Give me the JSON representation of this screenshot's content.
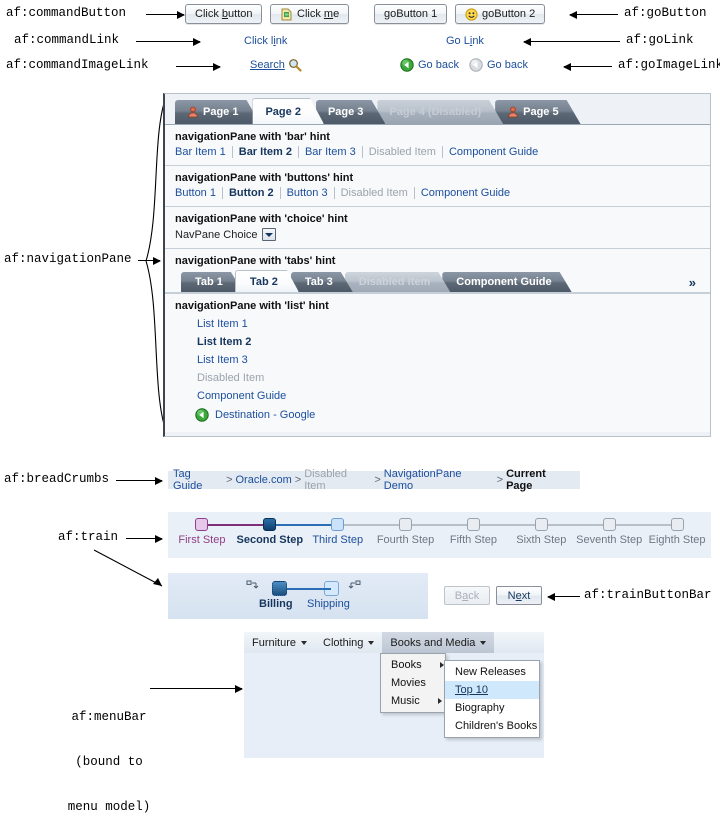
{
  "annotations": {
    "command_button": "af:commandButton",
    "command_link": "af:commandLink",
    "command_image_link": "af:commandImageLink",
    "go_button": "af:goButton",
    "go_link": "af:goLink",
    "go_image_link": "af:goImageLink",
    "navigation_pane": "af:navigationPane",
    "bread_crumbs": "af:breadCrumbs",
    "train": "af:train",
    "train_button_bar": "af:trainButtonBar",
    "menu_bar_line1": "af:menuBar",
    "menu_bar_line2": "(bound to",
    "menu_bar_line3": "menu model)"
  },
  "top_controls": {
    "command_button_1": {
      "pre": "Click ",
      "key": "b",
      "post": "utton"
    },
    "command_button_2": {
      "pre": "Click ",
      "key": "m",
      "post": "e",
      "icon": "page-arrow-icon"
    },
    "go_button_1": {
      "label": "goButton 1"
    },
    "go_button_2": {
      "pre": "goButton 2",
      "icon": "smiley-icon"
    },
    "command_link": {
      "pre": "Click l",
      "key": "i",
      "post": "nk"
    },
    "go_link": {
      "pre": "Go L",
      "key": "i",
      "post": "nk"
    },
    "command_image_link": {
      "label": "Search",
      "icon": "magnifier-icon"
    },
    "go_image_link_1": {
      "label": "Go back",
      "icon": "back-arrow-green-icon"
    },
    "go_image_link_2": {
      "label": "Go back",
      "icon": "back-arrow-gray-icon"
    }
  },
  "nav_panel": {
    "page_tabs": [
      {
        "label": "Page 1",
        "state": "normal",
        "icon": "user-icon"
      },
      {
        "label": "Page 2",
        "state": "selected",
        "icon": ""
      },
      {
        "label": "Page 3",
        "state": "normal",
        "icon": ""
      },
      {
        "label": "Page 4 (Disabled)",
        "state": "disabled",
        "icon": ""
      },
      {
        "label": "Page 5",
        "state": "normal",
        "icon": "user-icon"
      }
    ],
    "sections": [
      {
        "title": "navigationPane with 'bar' hint",
        "items": [
          {
            "label": "Bar Item 1",
            "state": "normal"
          },
          {
            "label": "Bar Item 2",
            "state": "current"
          },
          {
            "label": "Bar Item 3",
            "state": "normal"
          },
          {
            "label": "Disabled Item",
            "state": "disabled"
          },
          {
            "label": "Component Guide",
            "state": "normal"
          }
        ]
      },
      {
        "title": "navigationPane with 'buttons' hint",
        "items": [
          {
            "label": "Button 1",
            "state": "normal"
          },
          {
            "label": "Button 2",
            "state": "current"
          },
          {
            "label": "Button 3",
            "state": "normal"
          },
          {
            "label": "Disabled Item",
            "state": "disabled"
          },
          {
            "label": "Component Guide",
            "state": "normal"
          }
        ]
      }
    ],
    "choice_section": {
      "title": "navigationPane with 'choice' hint",
      "selected": "NavPane Choice"
    },
    "tabs_section": {
      "title": "navigationPane with 'tabs' hint",
      "tabs": [
        {
          "label": "Tab 1",
          "state": "normal"
        },
        {
          "label": "Tab 2",
          "state": "selected"
        },
        {
          "label": "Tab 3",
          "state": "normal"
        },
        {
          "label": "Disabled Item",
          "state": "disabled"
        },
        {
          "label": "Component Guide",
          "state": "normal"
        }
      ],
      "overflow": "»"
    },
    "list_section": {
      "title": "navigationPane with 'list' hint",
      "items": [
        {
          "label": "List Item 1",
          "state": "normal"
        },
        {
          "label": "List Item 2",
          "state": "current"
        },
        {
          "label": "List Item 3",
          "state": "normal"
        },
        {
          "label": "Disabled Item",
          "state": "disabled"
        },
        {
          "label": "Component Guide",
          "state": "normal"
        },
        {
          "label": "Destination - Google",
          "state": "normal",
          "icon": "back-arrow-green-icon"
        }
      ]
    }
  },
  "breadcrumbs": {
    "separator": ">",
    "items": [
      {
        "label": "Tag Guide",
        "state": "normal"
      },
      {
        "label": "Oracle.com",
        "state": "normal"
      },
      {
        "label": "Disabled Item",
        "state": "disabled"
      },
      {
        "label": "NavigationPane Demo",
        "state": "normal"
      },
      {
        "label": "Current Page",
        "state": "current"
      }
    ]
  },
  "train": {
    "steps": [
      {
        "label": "First Step",
        "state": "visited"
      },
      {
        "label": "Second Step",
        "state": "current"
      },
      {
        "label": "Third Step",
        "state": "next"
      },
      {
        "label": "Fourth Step",
        "state": "future"
      },
      {
        "label": "Fifth Step",
        "state": "future"
      },
      {
        "label": "Sixth Step",
        "state": "future"
      },
      {
        "label": "Seventh Step",
        "state": "future"
      },
      {
        "label": "Eighth Step",
        "state": "future"
      }
    ],
    "colors": {
      "visited": "#8f3f86",
      "current": "#17365d",
      "next": "#1c4e9c",
      "future": "#6f7783"
    }
  },
  "mini_train": {
    "steps": [
      {
        "label": "Billing",
        "state": "current"
      },
      {
        "label": "Shipping",
        "state": "next"
      }
    ]
  },
  "train_buttons": {
    "back": {
      "pre": "B",
      "key": "a",
      "post": "ck",
      "state": "disabled"
    },
    "next": {
      "pre": "N",
      "key": "e",
      "post": "xt",
      "state": "enabled"
    }
  },
  "menu_bar": {
    "items": [
      {
        "label": "Furniture",
        "state": "normal"
      },
      {
        "label": "Clothing",
        "state": "normal"
      },
      {
        "label": "Books and Media",
        "state": "open"
      }
    ],
    "submenu": [
      {
        "label": "Books",
        "has_children": true
      },
      {
        "label": "Movies",
        "has_children": true
      },
      {
        "label": "Music",
        "has_children": true
      }
    ],
    "subsubmenu": [
      {
        "label": "New Releases",
        "state": "normal"
      },
      {
        "label": "Top 10",
        "state": "highlighted"
      },
      {
        "label": "Biography",
        "state": "normal"
      },
      {
        "label": "Children's Books",
        "state": "normal"
      }
    ]
  }
}
